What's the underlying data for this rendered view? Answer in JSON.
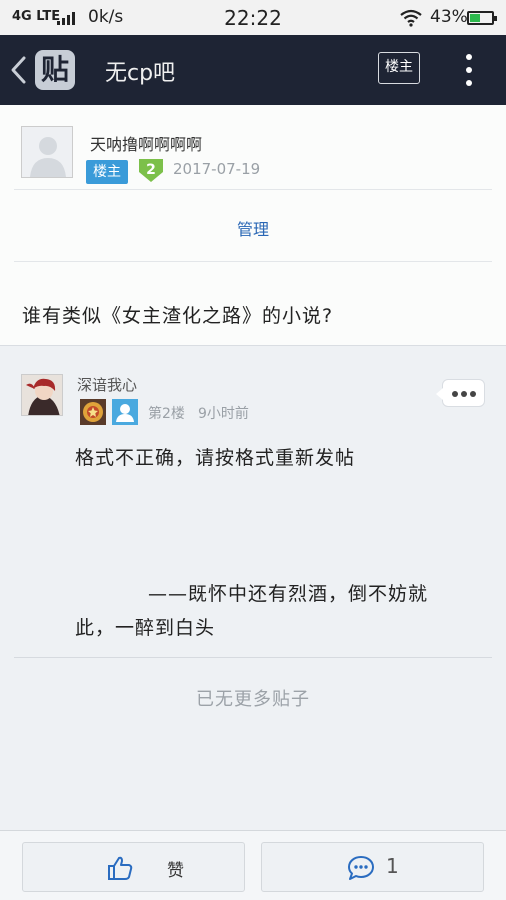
{
  "status_bar": {
    "network": "4G LTE",
    "speed": "0k/s",
    "time": "22:22",
    "battery": "43%",
    "battery_level": 0.43
  },
  "header": {
    "logo_char": "贴",
    "title": "无cp吧",
    "lz_button": "楼主"
  },
  "main_post": {
    "username": "天呐撸啊啊啊啊",
    "lz_tag": "楼主",
    "level": "2",
    "date": "2017-07-19",
    "manage_label": "管理",
    "content": "谁有类似《女主渣化之路》的小说?"
  },
  "reply": {
    "username": "深谙我心",
    "floor": "第2楼",
    "time": "9小时前",
    "content_line1": "格式不正确，请按格式重新发帖",
    "content_line2": "——既怀中还有烈酒，倒不妨就",
    "content_line3": "此，一醉到白头"
  },
  "footer": {
    "no_more": "已无更多贴子",
    "like_label": "赞",
    "comment_count": "1"
  },
  "colors": {
    "nav_bg": "#1e2434",
    "accent_blue": "#3a9bd9",
    "level_green": "#7cc04a",
    "link_blue": "#2a67b5"
  }
}
